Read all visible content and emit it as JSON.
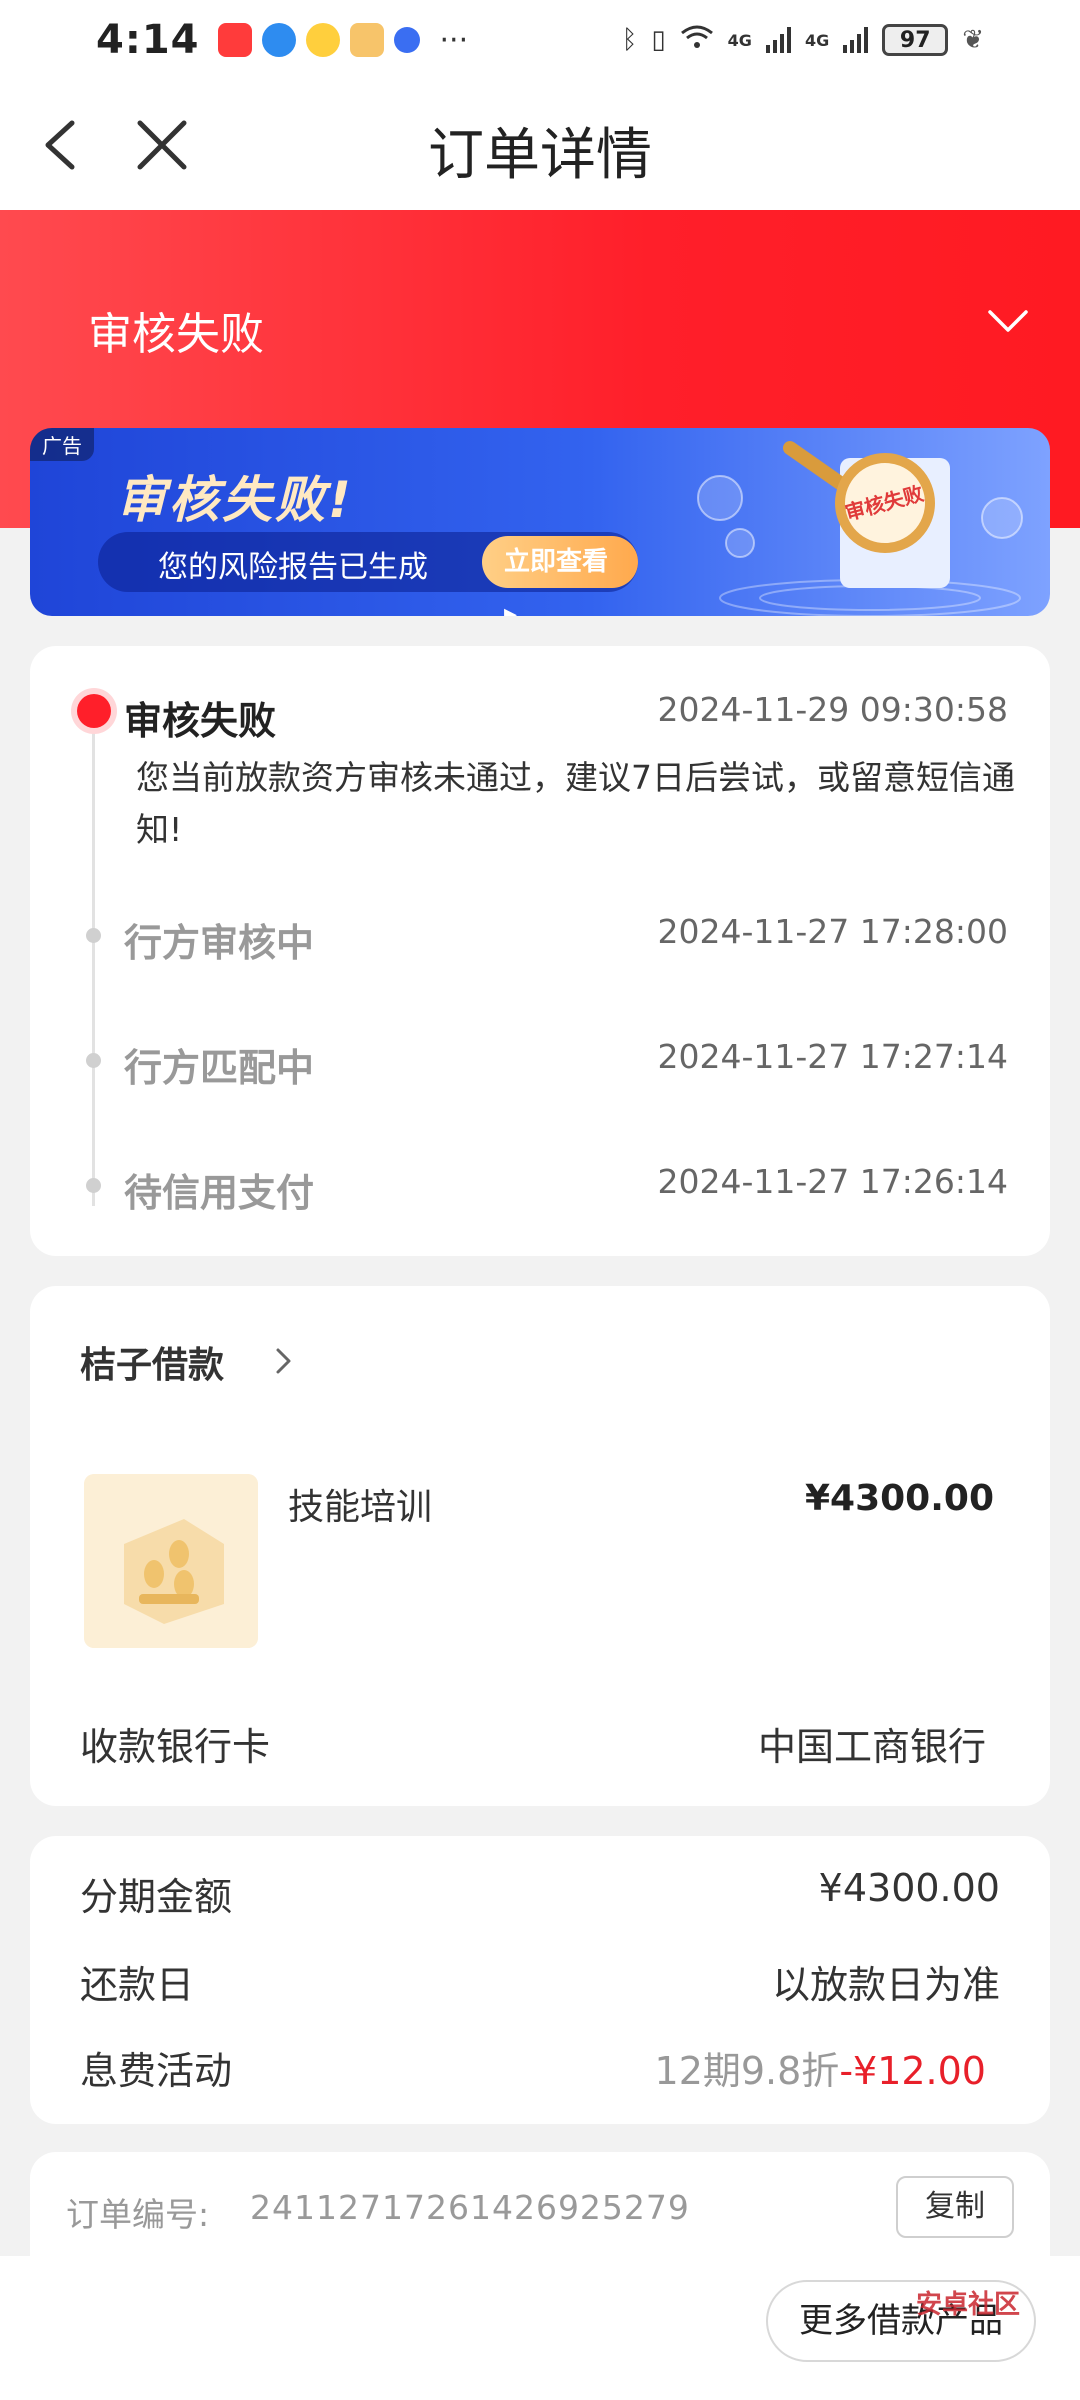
{
  "status_bar": {
    "time": "4:14",
    "more": "···",
    "battery": "97",
    "net_a": "4G",
    "net_b": "4G"
  },
  "nav": {
    "title": "订单详情"
  },
  "header": {
    "status": "审核失败"
  },
  "ad": {
    "tag": "广告",
    "title": "审核失败!",
    "subtitle": "您的风险报告已生成",
    "cta": "立即查看"
  },
  "timeline": [
    {
      "label": "审核失败",
      "time": "2024-11-29 09:30:58",
      "desc": "您当前放款资方审核未通过，建议7日后尝试，或留意短信通知!"
    },
    {
      "label": "行方审核中",
      "time": "2024-11-27 17:28:00"
    },
    {
      "label": "行方匹配中",
      "time": "2024-11-27 17:27:14"
    },
    {
      "label": "待信用支付",
      "time": "2024-11-27 17:26:14"
    }
  ],
  "product": {
    "merchant": "桔子借款",
    "name": "技能培训",
    "price": "¥4300.00",
    "bank_label": "收款银行卡",
    "bank_value": "中国工商银行"
  },
  "installment": {
    "amount_label": "分期金额",
    "amount_value": "¥4300.00",
    "repay_label": "还款日",
    "repay_value": "以放款日为准",
    "promo_label": "息费活动",
    "promo_plan": "12期9.8折",
    "promo_discount": "-¥12.00"
  },
  "order": {
    "label": "订单编号:",
    "number": "24112717261426925279",
    "copy": "复制"
  },
  "bottom": {
    "more_button": "更多借款产品",
    "watermark": "安卓社区"
  },
  "colors": {
    "accent_red": "#ff1f2a",
    "ad_blue": "#2a54e6",
    "discount_red": "#e8202a"
  }
}
